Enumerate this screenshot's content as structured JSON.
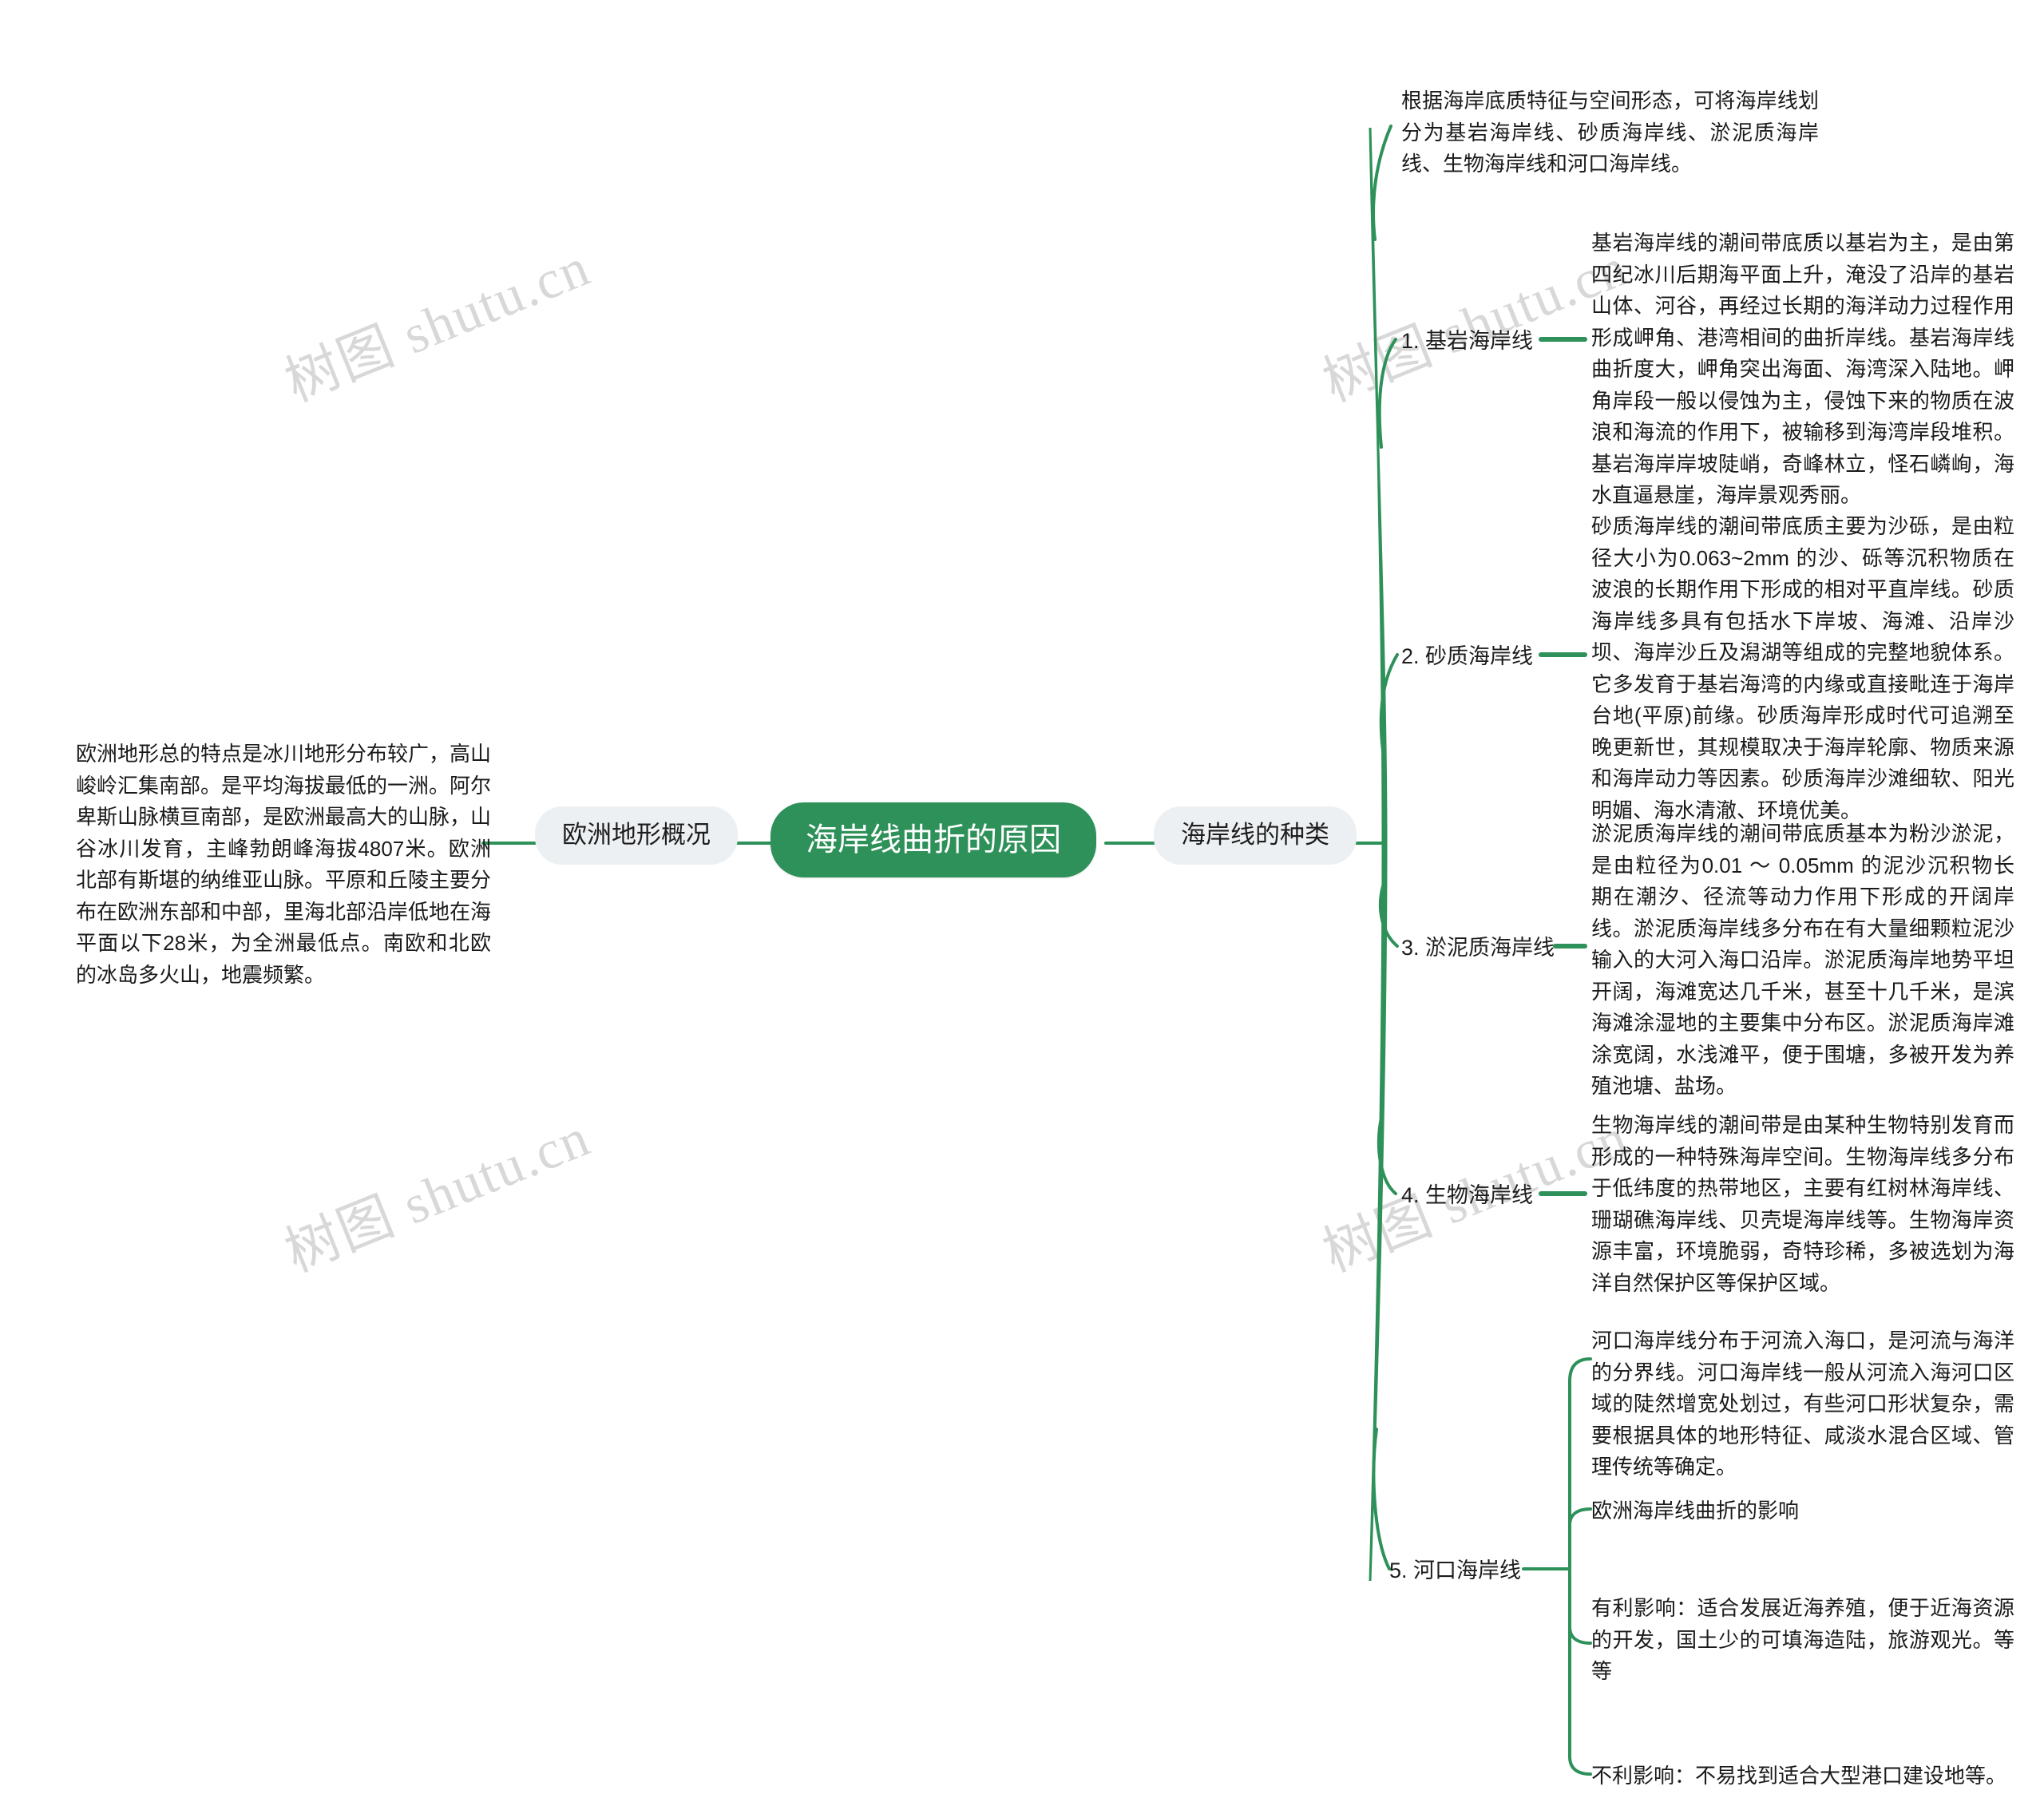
{
  "watermark": {
    "text": "树图 shutu.cn",
    "color": "#d8d8d8"
  },
  "theme": {
    "accent": "#2E9159",
    "root_text": "#ffffff",
    "pill_bg": "#EDF0F2",
    "body_text": "#1a1a1a",
    "page_bg": "#ffffff"
  },
  "root": {
    "label": "海岸线曲折的原因"
  },
  "left_branch": {
    "label": "欧洲地形概况",
    "detail": "欧洲地形总的特点是冰川地形分布较广，高山峻岭汇集南部。是平均海拔最低的一洲。阿尔卑斯山脉横亘南部，是欧洲最高大的山脉，山谷冰川发育，主峰勃朗峰海拔4807米。欧洲北部有斯堪的纳维亚山脉。平原和丘陵主要分布在欧洲东部和中部，里海北部沿岸低地在海平面以下28米，为全洲最低点。南欧和北欧的冰岛多火山，地震频繁。"
  },
  "right_branch": {
    "label": "海岸线的种类",
    "overview": "根据海岸底质特征与空间形态，可将海岸线划分为基岩海岸线、砂质海岸线、淤泥质海岸线、生物海岸线和河口海岸线。",
    "types": [
      {
        "label": "1. 基岩海岸线",
        "detail": "基岩海岸线的潮间带底质以基岩为主，是由第四纪冰川后期海平面上升，淹没了沿岸的基岩山体、河谷，再经过长期的海洋动力过程作用形成岬角、港湾相间的曲折岸线。基岩海岸线曲折度大，岬角突出海面、海湾深入陆地。岬角岸段一般以侵蚀为主，侵蚀下来的物质在波浪和海流的作用下，被输移到海湾岸段堆积。基岩海岸岸坡陡峭，奇峰林立，怪石嶙峋，海水直逼悬崖，海岸景观秀丽。"
      },
      {
        "label": "2. 砂质海岸线",
        "detail": "砂质海岸线的潮间带底质主要为沙砾，是由粒径大小为0.063~2mm 的沙、砾等沉积物质在波浪的长期作用下形成的相对平直岸线。砂质海岸线多具有包括水下岸坡、海滩、沿岸沙坝、海岸沙丘及潟湖等组成的完整地貌体系。它多发育于基岩海湾的内缘或直接毗连于海岸台地(平原)前缘。砂质海岸形成时代可追溯至晚更新世，其规模取决于海岸轮廓、物质来源和海岸动力等因素。砂质海岸沙滩细软、阳光明媚、海水清澈、环境优美。"
      },
      {
        "label": "3. 淤泥质海岸线",
        "detail": "淤泥质海岸线的潮间带底质基本为粉沙淤泥，是由粒径为0.01 ～ 0.05mm 的泥沙沉积物长期在潮汐、径流等动力作用下形成的开阔岸线。淤泥质海岸线多分布在有大量细颗粒泥沙输入的大河入海口沿岸。淤泥质海岸地势平坦开阔，海滩宽达几千米，甚至十几千米，是滨海滩涂湿地的主要集中分布区。淤泥质海岸滩涂宽阔，水浅滩平，便于围塘，多被开发为养殖池塘、盐场。"
      },
      {
        "label": "4. 生物海岸线",
        "detail": "生物海岸线的潮间带是由某种生物特别发育而形成的一种特殊海岸空间。生物海岸线多分布于低纬度的热带地区，主要有红树林海岸线、珊瑚礁海岸线、贝壳堤海岸线等。生物海岸资源丰富，环境脆弱，奇特珍稀，多被选划为海洋自然保护区等保护区域。"
      },
      {
        "label": "5. 河口海岸线",
        "detail": "河口海岸线分布于河流入海口，是河流与海洋的分界线。河口海岸线一般从河流入海河口区域的陡然增宽处划过，有些河口形状复杂，需要根据具体的地形特征、咸淡水混合区域、管理传统等确定。",
        "children": [
          {
            "label": "欧洲海岸线曲折的影响"
          },
          {
            "label": "有利影响：适合发展近海养殖，便于近海资源的开发，国土少的可填海造陆，旅游观光。等等"
          },
          {
            "label": "不利影响：不易找到适合大型港口建设地等。"
          }
        ]
      }
    ]
  }
}
